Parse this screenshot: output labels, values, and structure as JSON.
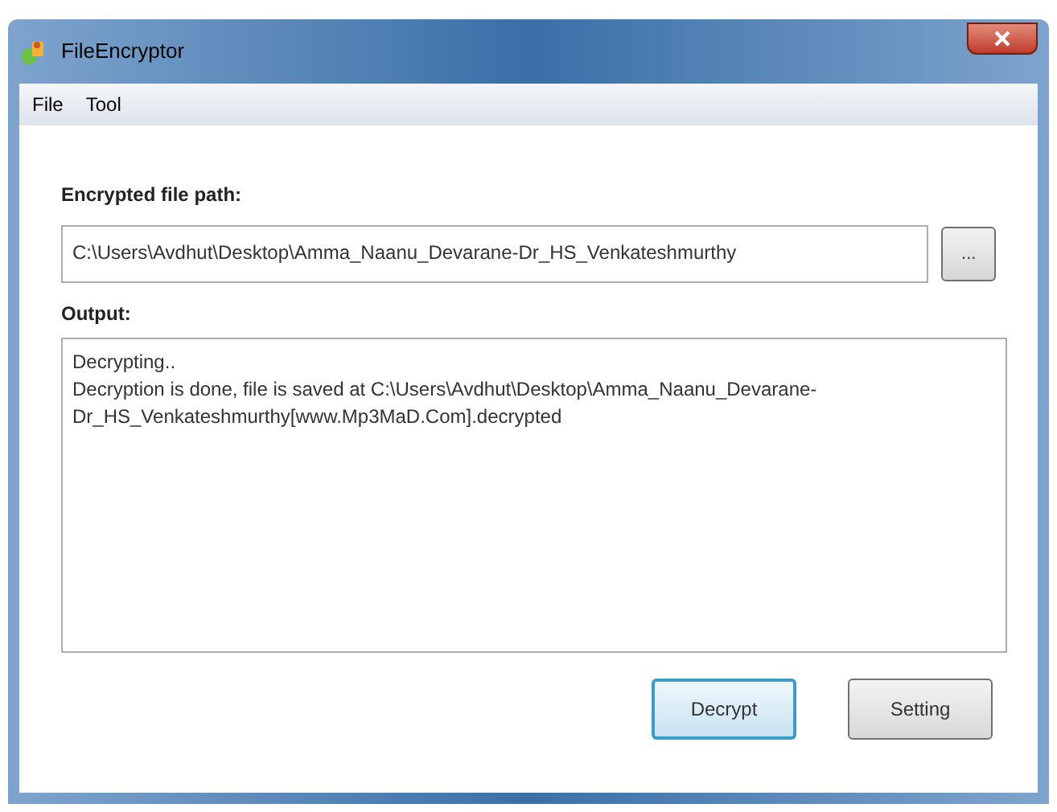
{
  "window": {
    "title": "FileEncryptor"
  },
  "menu": [
    "File",
    "Tool"
  ],
  "path_label": "Encrypted file path:",
  "path_field": {
    "value": "C:\\Users\\Avdhut\\Desktop\\Amma_Naanu_Devarane-Dr_HS_Venkateshmurthy"
  },
  "browse_button": "...",
  "output_label": "Output:",
  "output_lines": [
    "Decrypting..",
    "Decryption is done, file is saved at C:\\Users\\Avdhut\\Desktop\\Amma_Naanu_Devarane-Dr_HS_Venkateshmurthy[www.Mp3MaD.Com].decrypted"
  ],
  "buttons": [
    {
      "label": "Decrypt",
      "kind": "default"
    },
    {
      "label": "Setting",
      "kind": "normal"
    }
  ]
}
